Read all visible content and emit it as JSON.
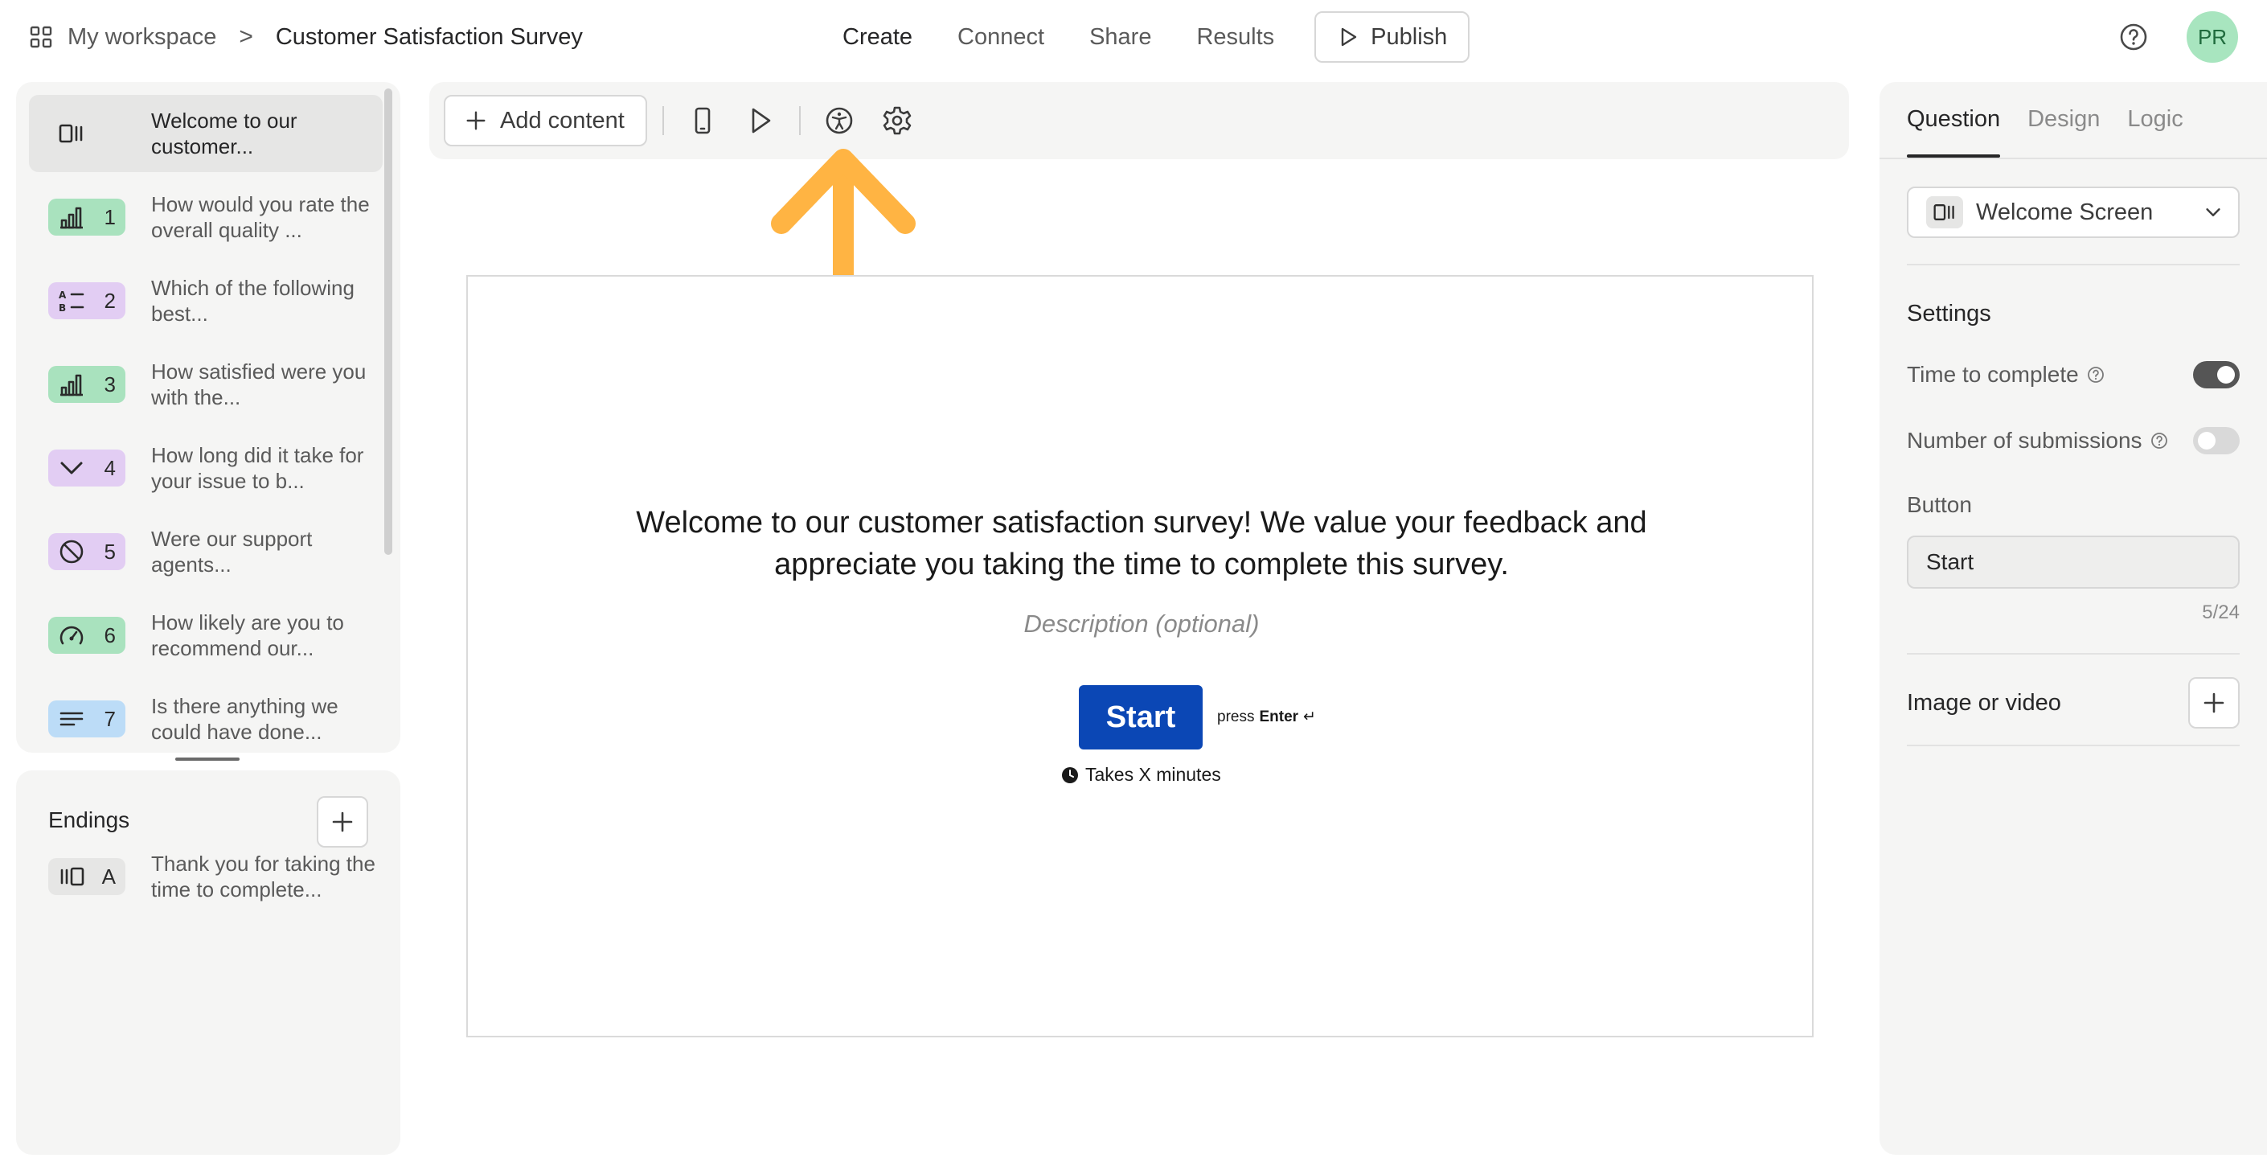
{
  "breadcrumb": {
    "workspace": "My workspace",
    "separator": ">",
    "title": "Customer Satisfaction Survey"
  },
  "topnav": {
    "items": [
      "Create",
      "Connect",
      "Share",
      "Results"
    ],
    "active": "Create",
    "publish_label": "Publish"
  },
  "user": {
    "initials": "PR"
  },
  "questions": [
    {
      "num": "",
      "text": "Welcome to our customer...",
      "icon": "welcome-screen-icon",
      "color": "#e6e6e5"
    },
    {
      "num": "1",
      "text": "How would you rate the overall quality ...",
      "icon": "rating-icon",
      "color": "#a9e2be"
    },
    {
      "num": "2",
      "text": "Which of the following best...",
      "icon": "multiple-choice-icon",
      "color": "#e2cdf3"
    },
    {
      "num": "3",
      "text": "How satisfied were you with the...",
      "icon": "rating-icon",
      "color": "#a9e2be"
    },
    {
      "num": "4",
      "text": "How long did it take for your issue to b...",
      "icon": "dropdown-icon",
      "color": "#e2cdf3"
    },
    {
      "num": "5",
      "text": "Were our support agents...",
      "icon": "yes-no-icon",
      "color": "#e2cdf3"
    },
    {
      "num": "6",
      "text": "How likely are you to recommend our...",
      "icon": "gauge-icon",
      "color": "#a9e2be"
    },
    {
      "num": "7",
      "text": "Is there anything we could have done...",
      "icon": "long-text-icon",
      "color": "#bcdcf7"
    }
  ],
  "endings": {
    "title": "Endings",
    "items": [
      {
        "letter": "A",
        "text": "Thank you for taking the time to complete...",
        "icon": "ending-screen-icon",
        "color": "#e6e6e5"
      }
    ]
  },
  "toolbar": {
    "add_content_label": "Add content"
  },
  "canvas": {
    "title": "Welcome to our customer satisfaction survey! We value your feedback and appreciate you taking the time to complete this survey.",
    "description_placeholder": "Description (optional)",
    "start_label": "Start",
    "press_label": "press",
    "enter_label": "Enter",
    "enter_glyph": "↵",
    "takes_label": "Takes X minutes",
    "accent": "#0b47b5"
  },
  "annotation": {
    "arrow_color": "#ffb443"
  },
  "right_panel": {
    "tabs": [
      "Question",
      "Design",
      "Logic"
    ],
    "active_tab": "Question",
    "type_label": "Welcome Screen",
    "settings_title": "Settings",
    "time_to_complete": {
      "label": "Time to complete",
      "on": true
    },
    "number_of_submissions": {
      "label": "Number of submissions",
      "on": false
    },
    "button_label": "Button",
    "button_value": "Start",
    "char_count": "5/24",
    "image_label": "Image or video"
  }
}
